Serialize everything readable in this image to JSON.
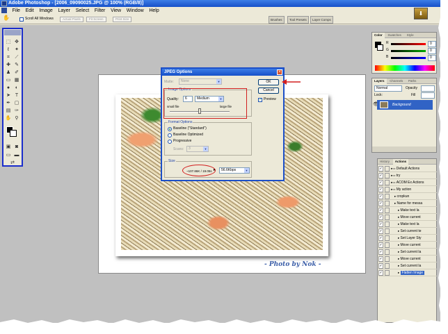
{
  "window": {
    "title": "Adobe Photoshop - [2006_09090025.JPG @ 100% (RGB/8)]"
  },
  "menu": [
    "File",
    "Edit",
    "Image",
    "Layer",
    "Select",
    "Filter",
    "View",
    "Window",
    "Help"
  ],
  "options_bar": {
    "scroll_all_windows": "Scroll All Windows",
    "actual_pixels": "Actual Pixels",
    "fit_screen": "Fit Screen",
    "print_size": "Print Size"
  },
  "palette_well": {
    "tabs": [
      "Brushes",
      "Tool Presets",
      "Layer Comps"
    ]
  },
  "color_panel": {
    "tabs": [
      "Color",
      "Swatches",
      "Style"
    ],
    "channels": [
      "R",
      "G",
      "B"
    ],
    "values": [
      "0",
      "0",
      "0"
    ]
  },
  "layers_panel": {
    "tabs": [
      "Layers",
      "Channels",
      "Paths"
    ],
    "blend_mode": "Normal",
    "opacity_label": "Opacity",
    "lock_label": "Lock:",
    "fill_label": "Fill",
    "layer_name": "Background"
  },
  "actions_panel": {
    "tabs": [
      "History",
      "Actions"
    ],
    "items": [
      {
        "label": "Default Actions",
        "indent": 0,
        "folder": true,
        "selected": false
      },
      {
        "label": "try",
        "indent": 0,
        "folder": true,
        "selected": false
      },
      {
        "label": "ACOM Ex Actions",
        "indent": 0,
        "folder": true,
        "selected": false
      },
      {
        "label": "My action",
        "indent": 0,
        "folder": true,
        "selected": false
      },
      {
        "label": "cropkun",
        "indent": 1,
        "folder": false,
        "selected": false
      },
      {
        "label": "Name for messa",
        "indent": 1,
        "folder": false,
        "selected": false
      },
      {
        "label": "Make text la",
        "indent": 2,
        "folder": false,
        "selected": false
      },
      {
        "label": "Move current",
        "indent": 2,
        "folder": false,
        "selected": false
      },
      {
        "label": "Make text la",
        "indent": 2,
        "folder": false,
        "selected": false
      },
      {
        "label": "Set current te",
        "indent": 2,
        "folder": false,
        "selected": false
      },
      {
        "label": "Set Layer Sty",
        "indent": 2,
        "folder": false,
        "selected": false
      },
      {
        "label": "Move current",
        "indent": 2,
        "folder": false,
        "selected": false
      },
      {
        "label": "Set current la",
        "indent": 2,
        "folder": false,
        "selected": false
      },
      {
        "label": "Move current",
        "indent": 2,
        "folder": false,
        "selected": false
      },
      {
        "label": "Set current la",
        "indent": 2,
        "folder": false,
        "selected": false
      },
      {
        "label": "Flatten Image",
        "indent": 2,
        "folder": false,
        "selected": true
      }
    ]
  },
  "dialog": {
    "title": "JPEG Options",
    "matte_label": "Matte:",
    "matte_value": "None",
    "image_options_title": "Image Options",
    "quality_label": "Quality:",
    "quality_value": "6",
    "quality_preset": "Medium",
    "slider_min_label": "small file",
    "slider_max_label": "large file",
    "quality_level_fraction": 0.5,
    "format_options_title": "Format Options",
    "formats": [
      "Baseline (\"Standard\")",
      "Baseline Optimized",
      "Progressive"
    ],
    "selected_format": 0,
    "scans_label": "Scans:",
    "scans_value": "3",
    "size_title": "Size",
    "size_estimate": "~107.86K / 19.05s",
    "connection_speed": "56.6Kbps",
    "ok_label": "OK",
    "cancel_label": "Cancel",
    "preview_label": "Preview",
    "preview_checked": true
  },
  "document": {
    "photo_credit": "- Photo by Nok -"
  },
  "annotations": {
    "highlight_color": "#d21f1f"
  },
  "colors": {
    "accent": "#1650c8",
    "selection": "#3163c5",
    "workspace": "#c0c0c0"
  }
}
